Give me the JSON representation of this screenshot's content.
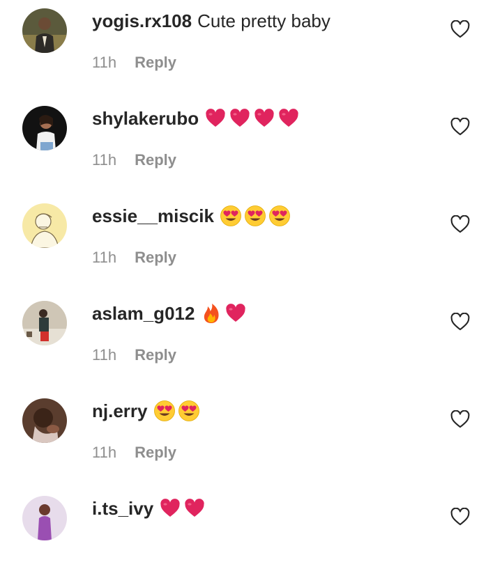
{
  "comments": [
    {
      "username": "yogis.rx108",
      "text": "Cute pretty baby",
      "emojis": [],
      "time": "11h",
      "reply": "Reply",
      "avatar": "avatar-man-suit"
    },
    {
      "username": "shylakerubo",
      "text": "",
      "emojis": [
        "heart",
        "heart",
        "heart",
        "heart"
      ],
      "time": "11h",
      "reply": "Reply",
      "avatar": "avatar-woman-dark"
    },
    {
      "username": "essie__miscik",
      "text": "",
      "emojis": [
        "heart-eyes",
        "heart-eyes",
        "heart-eyes"
      ],
      "time": "11h",
      "reply": "Reply",
      "avatar": "avatar-sketch-yellow"
    },
    {
      "username": "aslam_g012",
      "text": "",
      "emojis": [
        "fire",
        "heart"
      ],
      "time": "11h",
      "reply": "Reply",
      "avatar": "avatar-man-red"
    },
    {
      "username": "nj.erry",
      "text": "",
      "emojis": [
        "heart-eyes",
        "heart-eyes"
      ],
      "time": "11h",
      "reply": "Reply",
      "avatar": "avatar-baby"
    },
    {
      "username": "i.ts_ivy",
      "text": "",
      "emojis": [
        "heart",
        "heart"
      ],
      "time": "",
      "reply": "",
      "avatar": "avatar-woman-purple"
    }
  ],
  "colors": {
    "heart": "#e0245e",
    "emoji_face": "#ffcc33",
    "meta": "#8e8e8e",
    "text": "#262626"
  },
  "icons": {
    "like": "heart-outline-icon"
  }
}
